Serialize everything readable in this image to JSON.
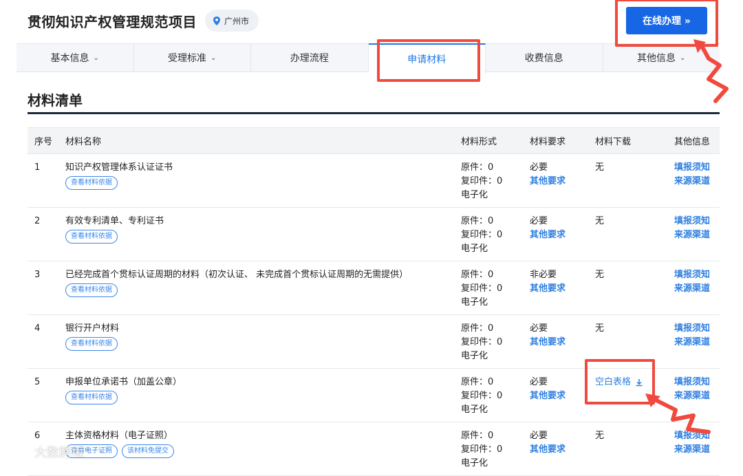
{
  "header": {
    "title": "贯彻知识产权管理规范项目",
    "location": "广州市",
    "apply_label": "在线办理 »"
  },
  "tabs": [
    {
      "label": "基本信息",
      "dropdown": true
    },
    {
      "label": "受理标准",
      "dropdown": true
    },
    {
      "label": "办理流程",
      "dropdown": false
    },
    {
      "label": "申请材料",
      "dropdown": false,
      "active": true
    },
    {
      "label": "收费信息",
      "dropdown": false
    },
    {
      "label": "其他信息",
      "dropdown": true
    }
  ],
  "section": {
    "title": "材料清单"
  },
  "table": {
    "headers": [
      "序号",
      "材料名称",
      "材料形式",
      "材料要求",
      "材料下载",
      "其他信息"
    ],
    "rows": [
      {
        "idx": "1",
        "name": "知识产权管理体系认证证书",
        "tags": [
          "查看材料依据"
        ],
        "form": [
          "原件：0",
          "复印件：0",
          "电子化"
        ],
        "req": "必要",
        "req_link": "其他要求",
        "download": "无",
        "info": [
          "填报须知",
          "来源渠道"
        ]
      },
      {
        "idx": "2",
        "name": "有效专利清单、专利证书",
        "tags": [
          "查看材料依据"
        ],
        "form": [
          "原件：0",
          "复印件：0",
          "电子化"
        ],
        "req": "必要",
        "req_link": "其他要求",
        "download": "无",
        "info": [
          "填报须知",
          "来源渠道"
        ]
      },
      {
        "idx": "3",
        "name": "已经完成首个贯标认证周期的材料（初次认证、 未完成首个贯标认证周期的无需提供）",
        "tags": [
          "查看材料依据"
        ],
        "form": [
          "原件：0",
          "复印件：0",
          "电子化"
        ],
        "req": "非必要",
        "req_link": "其他要求",
        "download": "无",
        "info": [
          "填报须知",
          "来源渠道"
        ]
      },
      {
        "idx": "4",
        "name": "银行开户材料",
        "tags": [
          "查看材料依据"
        ],
        "form": [
          "原件：0",
          "复印件：0",
          "电子化"
        ],
        "req": "必要",
        "req_link": "其他要求",
        "download": "无",
        "info": [
          "填报须知",
          "来源渠道"
        ]
      },
      {
        "idx": "5",
        "name": "申报单位承诺书（加盖公章）",
        "tags": [
          "查看材料依据"
        ],
        "form": [
          "原件：0",
          "复印件：0",
          "电子化"
        ],
        "req": "必要",
        "req_link": "其他要求",
        "download": "空白表格",
        "download_link": true,
        "info": [
          "填报须知",
          "来源渠道"
        ]
      },
      {
        "idx": "6",
        "name": "主体资格材料（电子证照）",
        "tags": [
          "查看电子证照",
          "该材料免提交"
        ],
        "form": [
          "原件：0",
          "复印件：0",
          "电子化"
        ],
        "req": "必要",
        "req_link": "其他要求",
        "download": "无",
        "info": [
          "填报须知",
          "来源渠道"
        ]
      }
    ]
  },
  "watermark": "大数跨境",
  "colors": {
    "accent": "#1766e6",
    "annotation": "#f04a3e",
    "link": "#2f7fe0"
  },
  "icons": [
    "location-pin-icon",
    "chevron-down-icon",
    "download-icon",
    "logo-icon"
  ]
}
